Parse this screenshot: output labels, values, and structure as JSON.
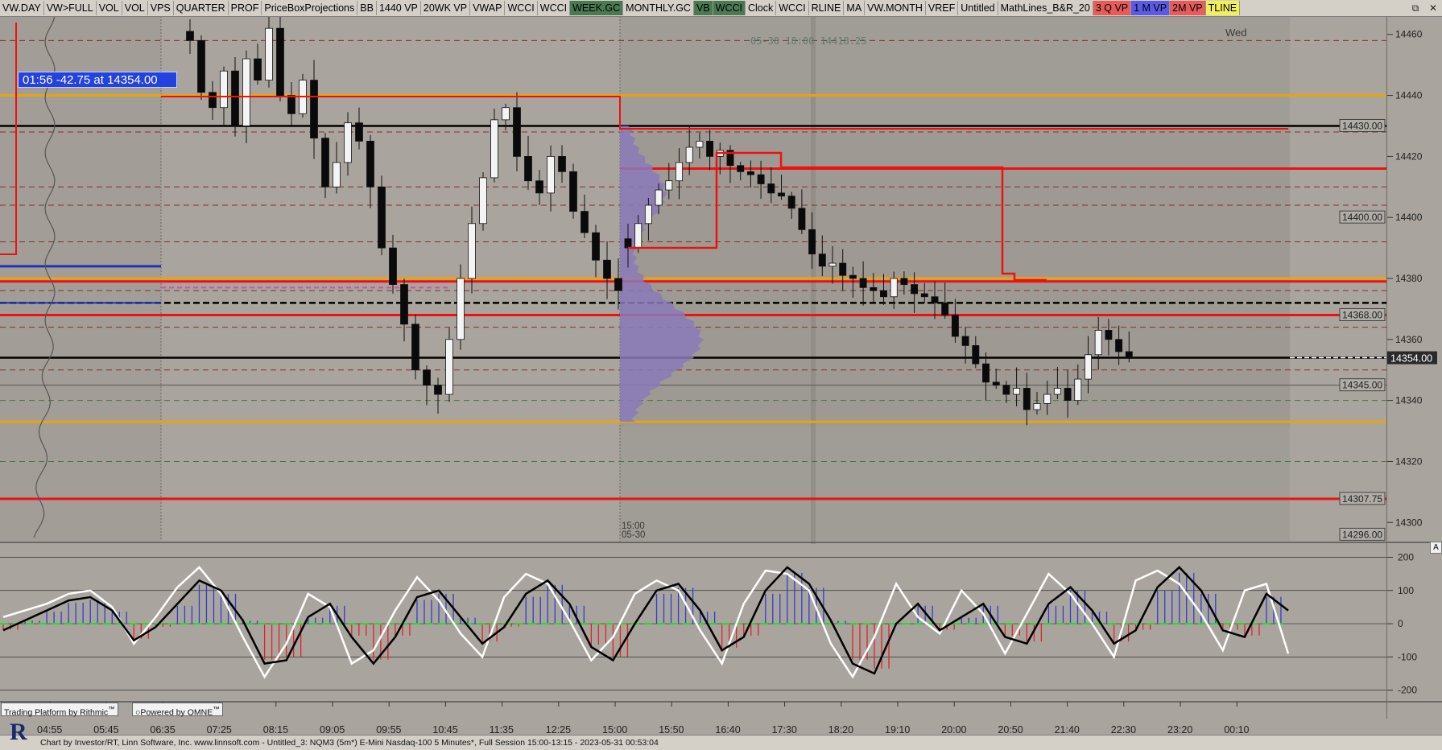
{
  "toolbar": {
    "buttons": [
      {
        "label": "VW.DAY",
        "bg": ""
      },
      {
        "label": "VW>FULL",
        "bg": ""
      },
      {
        "label": "VOL",
        "bg": ""
      },
      {
        "label": "VOL",
        "bg": ""
      },
      {
        "label": "VPS",
        "bg": ""
      },
      {
        "label": "QUARTER",
        "bg": ""
      },
      {
        "label": "PROF",
        "bg": ""
      },
      {
        "label": "PriceBoxProjections",
        "bg": ""
      },
      {
        "label": "BB",
        "bg": ""
      },
      {
        "label": "1440 VP",
        "bg": ""
      },
      {
        "label": "20WK VP",
        "bg": ""
      },
      {
        "label": "VWAP",
        "bg": ""
      },
      {
        "label": "WCCI",
        "bg": ""
      },
      {
        "label": "WCCI",
        "bg": ""
      },
      {
        "label": "WEEK.GC",
        "bg": "#4a7a52"
      },
      {
        "label": "MONTHLY.GC",
        "bg": ""
      },
      {
        "label": "VB",
        "bg": "#4a7a52"
      },
      {
        "label": "WCCI",
        "bg": "#4a7a52"
      },
      {
        "label": "Clock",
        "bg": ""
      },
      {
        "label": "WCCI",
        "bg": ""
      },
      {
        "label": "RLINE",
        "bg": ""
      },
      {
        "label": "MA",
        "bg": ""
      },
      {
        "label": "VW.MONTH",
        "bg": ""
      },
      {
        "label": "VREF",
        "bg": ""
      },
      {
        "label": "Untitled",
        "bg": ""
      },
      {
        "label": "MathLines_B&R_20",
        "bg": ""
      },
      {
        "label": "3 Q VP",
        "bg": "#e85b5b"
      },
      {
        "label": "1 M VP",
        "bg": "#5a5ae8"
      },
      {
        "label": "2M VP",
        "bg": "#e85b5b"
      },
      {
        "label": "TLINE",
        "bg": "#f2f05a"
      }
    ],
    "window_icons": [
      "restore-icon",
      "close-icon"
    ]
  },
  "last_trade_box": "01:56  -42.75 at 14354.00",
  "ohlc_stamp": "05-30 18:00 14418.25",
  "day_label": "Wed",
  "session_start": {
    "time": "15:00",
    "date": "05-30"
  },
  "price_scale": {
    "ticks": [
      "14460",
      "14440",
      "14420",
      "14400",
      "14380",
      "14360",
      "14340",
      "14320",
      "14300"
    ],
    "boxed_labels": [
      "14430.00",
      "14400.00",
      "14368.00",
      "14345.00",
      "14307.75",
      "14296.00"
    ],
    "current_price": "14354.00"
  },
  "indicator_scale": {
    "ticks": [
      "200",
      "100",
      "0",
      "-100",
      "-200"
    ],
    "flag": "A"
  },
  "time_axis": [
    "04:55",
    "05:45",
    "06:35",
    "07:25",
    "08:15",
    "09:05",
    "09:55",
    "10:45",
    "11:35",
    "12:25",
    "15:00",
    "15:50",
    "16:40",
    "17:30",
    "18:20",
    "19:10",
    "20:00",
    "20:50",
    "21:40",
    "22:30",
    "23:20",
    "00:10"
  ],
  "branding": {
    "left": "Trading Platform by Rithmic",
    "right": "Powered by OMNE"
  },
  "logo_letter": "R",
  "footer": "Chart by Investor/RT, Linn Software, Inc. www.linnsoft.com - Untitled_3: NQM3 (5m*) E-Mini Nasdaq-100 5 Minutes*, Full Session 15:00-13:15 - 2023-05-31 00:53:04",
  "colors": {
    "background": "#a9a59e",
    "session_bg": "#a09c96",
    "red_level": "#ee1111",
    "gold_level": "#e8a410",
    "blue_level": "#1f33b8",
    "profile": "#8a7ab8",
    "wcci_white": "#ffffff",
    "wcci_black": "#000000"
  },
  "chart_data": [
    {
      "type": "candlestick",
      "symbol": "NQM3 (5m*) E-Mini Nasdaq-100 5 Minutes",
      "ylim": [
        14294,
        14466
      ],
      "levels": [
        {
          "price": 14440,
          "color": "gold"
        },
        {
          "price": 14430,
          "color": "black"
        },
        {
          "price": 14416,
          "color": "red"
        },
        {
          "price": 14380,
          "color": "gold"
        },
        {
          "price": 14379,
          "color": "red"
        },
        {
          "price": 14372,
          "color": "black"
        },
        {
          "price": 14368,
          "color": "red"
        },
        {
          "price": 14354,
          "color": "black"
        },
        {
          "price": 14345,
          "color": "gray"
        },
        {
          "price": 14333,
          "color": "gold"
        },
        {
          "price": 14307.75,
          "color": "red"
        }
      ],
      "close_path_prior": [
        14458,
        14441,
        14436,
        14448,
        14430,
        14452,
        14445,
        14462,
        14440,
        14434,
        14445,
        14426,
        14410,
        14418,
        14431,
        14425,
        14410,
        14390,
        14378,
        14365,
        14350,
        14345,
        14342,
        14360,
        14380,
        14398,
        14413,
        14432,
        14436,
        14420,
        14412,
        14408,
        14420,
        14415,
        14402,
        14395,
        14386,
        14380,
        14376
      ],
      "close_path_session": [
        14390,
        14398,
        14404,
        14409,
        14412,
        14418,
        14423,
        14425,
        14420,
        14422,
        14417,
        14415,
        14414,
        14411,
        14408,
        14407,
        14403,
        14396,
        14388,
        14384,
        14385,
        14381,
        14380,
        14377,
        14376,
        14374,
        14380,
        14378,
        14375,
        14374,
        14372,
        14368,
        14361,
        14358,
        14352,
        14346,
        14345,
        14342,
        14344,
        14337,
        14339,
        14342,
        14344,
        14340,
        14347,
        14355,
        14363,
        14360,
        14356,
        14354
      ]
    },
    {
      "type": "line",
      "name": "WCCI",
      "ylim": [
        -230,
        240
      ],
      "series": [
        {
          "name": "white",
          "values": [
            20,
            40,
            60,
            90,
            100,
            50,
            -60,
            20,
            110,
            170,
            90,
            -40,
            -160,
            -60,
            90,
            50,
            -120,
            -80,
            40,
            140,
            70,
            -30,
            -100,
            80,
            150,
            120,
            10,
            -110,
            -40,
            90,
            130,
            100,
            -20,
            -120,
            60,
            160,
            150,
            100,
            -60,
            -160,
            -40,
            120,
            20,
            -30,
            100,
            30,
            -90,
            30,
            150,
            90,
            0,
            -100,
            130,
            160,
            120,
            30,
            -80,
            100,
            120,
            -90
          ]
        },
        {
          "name": "black",
          "values": [
            -20,
            10,
            40,
            70,
            80,
            40,
            -50,
            -10,
            60,
            130,
            100,
            10,
            -120,
            -110,
            20,
            60,
            -40,
            -120,
            -40,
            80,
            100,
            20,
            -60,
            -10,
            90,
            130,
            60,
            -70,
            -110,
            0,
            100,
            120,
            40,
            -80,
            -40,
            100,
            170,
            120,
            10,
            -120,
            -150,
            0,
            60,
            -20,
            20,
            60,
            -40,
            -60,
            60,
            110,
            40,
            -60,
            -20,
            110,
            170,
            100,
            -20,
            -40,
            90,
            40
          ]
        }
      ]
    }
  ]
}
